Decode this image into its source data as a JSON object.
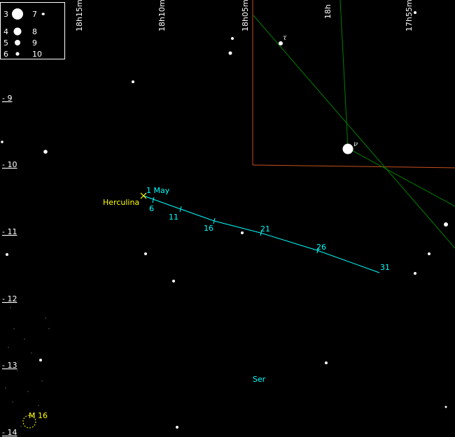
{
  "ra_labels": [
    "18h15m",
    "18h10m",
    "18h05m",
    "18h",
    "17h55m"
  ],
  "dec_labels": [
    "- 9",
    "- 10",
    "- 11",
    "- 12",
    "- 13",
    "- 14"
  ],
  "legend": {
    "entries": [
      {
        "mag": "3",
        "mag2": "7"
      },
      {
        "mag": "4",
        "mag2": "8"
      },
      {
        "mag": "5",
        "mag2": "9"
      },
      {
        "mag": "6",
        "mag2": "10"
      }
    ]
  },
  "asteroid": {
    "name": "Herculina",
    "start_label": "1 May",
    "date_labels": [
      "6",
      "11",
      "16",
      "21",
      "26",
      "31"
    ]
  },
  "star_labels": {
    "tau": "τ",
    "nu": "ν"
  },
  "constellation_label": "Ser",
  "deep_sky": {
    "label": "M 16"
  },
  "colors": {
    "background": "#000000",
    "track": "#00ffff",
    "asteroid_label": "#ffff00",
    "boundary": "#c8501e",
    "constellation_lines": "#008000",
    "stars": "#ffffff",
    "nebula": "#ffff00"
  }
}
